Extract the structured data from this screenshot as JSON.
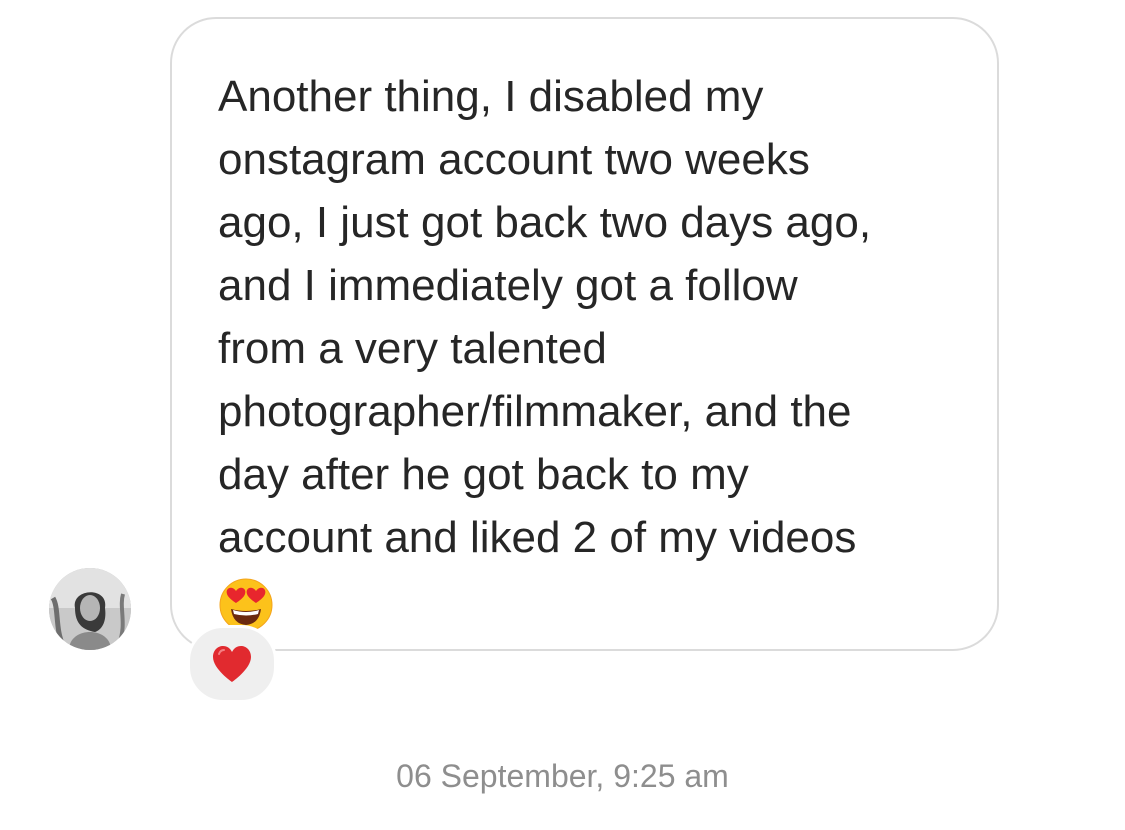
{
  "message": {
    "lines": [
      "Another thing,  I disabled my",
      "onstagram account two weeks",
      "ago, I just got back two days ago,",
      "and I immediately got a follow",
      "from a very talented",
      "photographer/filmmaker, and the",
      "day after he got back to my",
      "account and liked 2 of my videos"
    ],
    "emoji": "heart-eyes-emoji"
  },
  "reaction": {
    "emoji": "red-heart-emoji"
  },
  "sender": {
    "avatar": "profile-photo"
  },
  "timestamp": "06 September, 9:25 am",
  "colors": {
    "text": "#262626",
    "bubble_border": "#dbdbdb",
    "reaction_bg": "#efefef",
    "timestamp": "#8e8e8e"
  }
}
